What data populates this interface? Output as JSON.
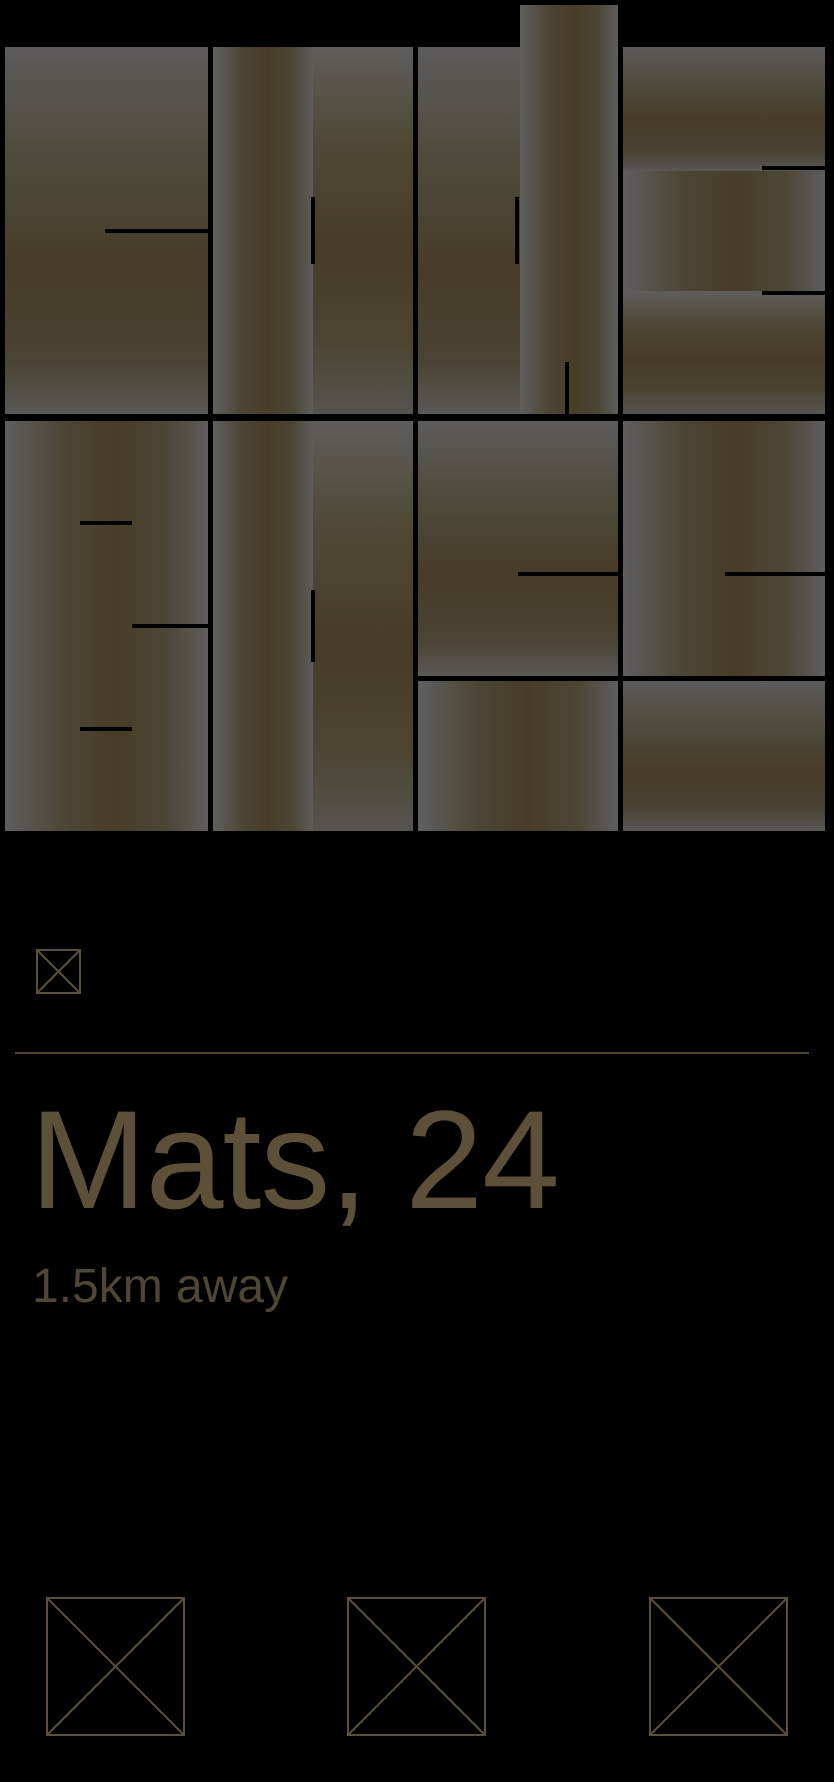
{
  "profile": {
    "name_age": "Mats, 24",
    "distance": "1.5km away"
  },
  "icons": {
    "info": "placeholder-x-icon",
    "action_left": "placeholder-x-icon",
    "action_middle": "placeholder-x-icon",
    "action_right": "placeholder-x-icon"
  },
  "colors": {
    "background": "#000000",
    "accent": "#5c5138",
    "placeholder_stroke": "#5a5039"
  }
}
